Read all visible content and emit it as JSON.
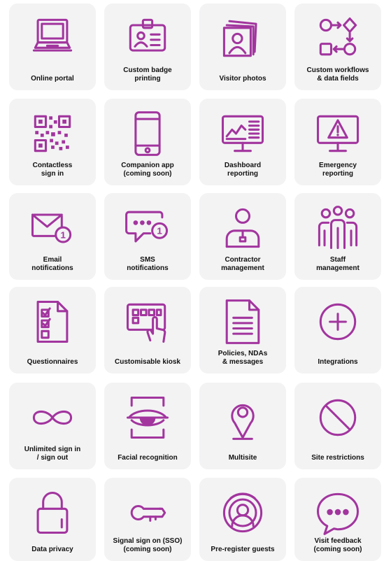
{
  "accent_color": "#a2359e",
  "tile_background": "#f3f3f4",
  "features": [
    {
      "label": "Online portal",
      "icon": "laptop-icon"
    },
    {
      "label": "Custom badge\nprinting",
      "icon": "id-badge-icon"
    },
    {
      "label": "Visitor photos",
      "icon": "photos-icon"
    },
    {
      "label": "Custom workflows\n& data fields",
      "icon": "workflow-icon"
    },
    {
      "label": "Contactless\nsign in",
      "icon": "qr-code-icon"
    },
    {
      "label": "Companion app\n(coming soon)",
      "icon": "smartphone-icon"
    },
    {
      "label": "Dashboard\nreporting",
      "icon": "dashboard-monitor-icon"
    },
    {
      "label": "Emergency\nreporting",
      "icon": "warning-monitor-icon"
    },
    {
      "label": "Email\nnotifications",
      "icon": "email-notification-icon"
    },
    {
      "label": "SMS\nnotifications",
      "icon": "sms-notification-icon"
    },
    {
      "label": "Contractor\nmanagement",
      "icon": "contractor-icon"
    },
    {
      "label": "Staff\nmanagement",
      "icon": "staff-group-icon"
    },
    {
      "label": "Questionnaires",
      "icon": "checklist-icon"
    },
    {
      "label": "Customisable kiosk",
      "icon": "kiosk-touch-icon"
    },
    {
      "label": "Policies, NDAs\n& messages",
      "icon": "document-icon"
    },
    {
      "label": "Integrations",
      "icon": "plus-circle-icon"
    },
    {
      "label": "Unlimited sign in\n/ sign out",
      "icon": "infinity-icon"
    },
    {
      "label": "Facial recognition",
      "icon": "eye-scan-icon"
    },
    {
      "label": "Multisite",
      "icon": "location-pin-icon"
    },
    {
      "label": "Site restrictions",
      "icon": "prohibited-icon"
    },
    {
      "label": "Data privacy",
      "icon": "padlock-icon"
    },
    {
      "label": "Signal sign on (SSO)\n(coming soon)",
      "icon": "key-icon"
    },
    {
      "label": "Pre-register guests",
      "icon": "user-circle-icon"
    },
    {
      "label": "Visit feedback\n(coming soon)",
      "icon": "chat-bubble-icon"
    }
  ],
  "icon_text": {
    "notification_count": "1"
  }
}
